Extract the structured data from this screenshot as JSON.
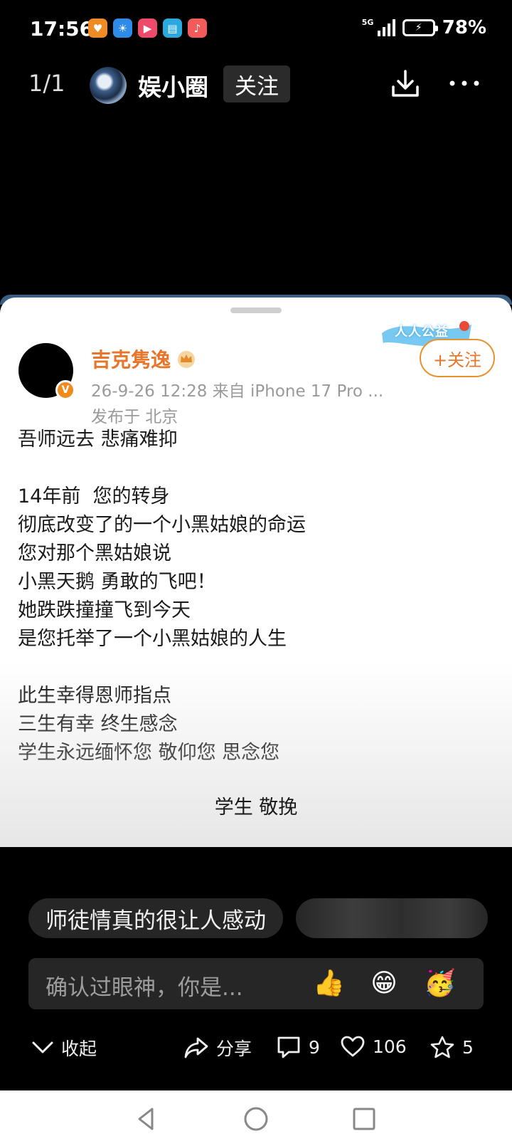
{
  "status_bar": {
    "time": "17:56",
    "network": "5G",
    "battery": "78%",
    "app_icons": [
      {
        "name": "taobao-icon",
        "color": "#f08a24",
        "glyph": "♥"
      },
      {
        "name": "weather-icon",
        "color": "#2f8bea",
        "glyph": "☀"
      },
      {
        "name": "video-icon",
        "color": "#f04a6a",
        "glyph": "▶"
      },
      {
        "name": "reader-icon",
        "color": "#2aa9e0",
        "glyph": "▤"
      },
      {
        "name": "music-icon",
        "color": "#f35a5a",
        "glyph": "♪"
      }
    ]
  },
  "top_nav": {
    "page_indicator": "1/1",
    "account_name": "娱小圈",
    "follow_label": "关注"
  },
  "post": {
    "author": "吉克隽逸",
    "meta": "26-9-26 12:28  来自 iPhone 17 Pro ...",
    "location": "发布于 北京",
    "sticker_text": "人人公益",
    "follow_label": "+关注",
    "lines": [
      "吾师远去 悲痛难抑",
      "",
      "14年前  您的转身",
      "彻底改变了的一个小黑姑娘的命运",
      "您对那个黑姑娘说",
      "小黑天鹅 勇敢的飞吧！",
      "她跌跌撞撞飞到今天",
      "是您托举了一个小黑姑娘的人生",
      "",
      "此生幸得恩师指点",
      "三生有幸 终生感念",
      "学生永远缅怀您 敬仰您 思念您"
    ],
    "signature": "学生 敬挽"
  },
  "comments": {
    "tags": [
      "师徒情真的很让人感动",
      ""
    ],
    "placeholder": "确认过眼神，你是...",
    "emojis": [
      "👍",
      "😁",
      "🥳"
    ]
  },
  "actions": {
    "collapse": "收起",
    "share": "分享",
    "comment_count": "9",
    "like_count": "106",
    "favorite_count": "5"
  },
  "colors": {
    "accent": "#e8762a",
    "background": "#000000",
    "card": "#ffffff"
  }
}
